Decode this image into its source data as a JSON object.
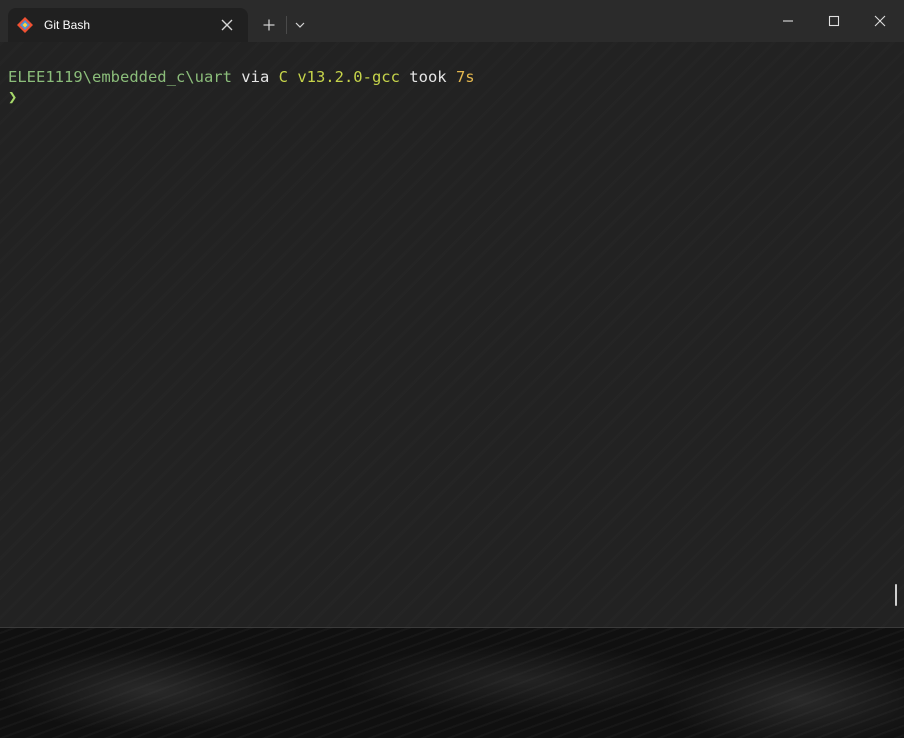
{
  "window": {
    "tab_title": "Git Bash",
    "tab_icon": "git-bash-icon"
  },
  "colors": {
    "path": "#8bbd7a",
    "plain": "#e6e6e6",
    "lang": "#c6d44a",
    "duration": "#e5b84f",
    "prompt": "#a6d86a",
    "git_orange": "#f05133",
    "git_blue": "#4a90d9"
  },
  "terminal": {
    "path": "ELEE1119\\embedded_c\\uart",
    "via": " via ",
    "lang_symbol": "C",
    "version": " v13.2.0-gcc",
    "took": " took ",
    "duration": "7s",
    "prompt_char": "❯"
  }
}
